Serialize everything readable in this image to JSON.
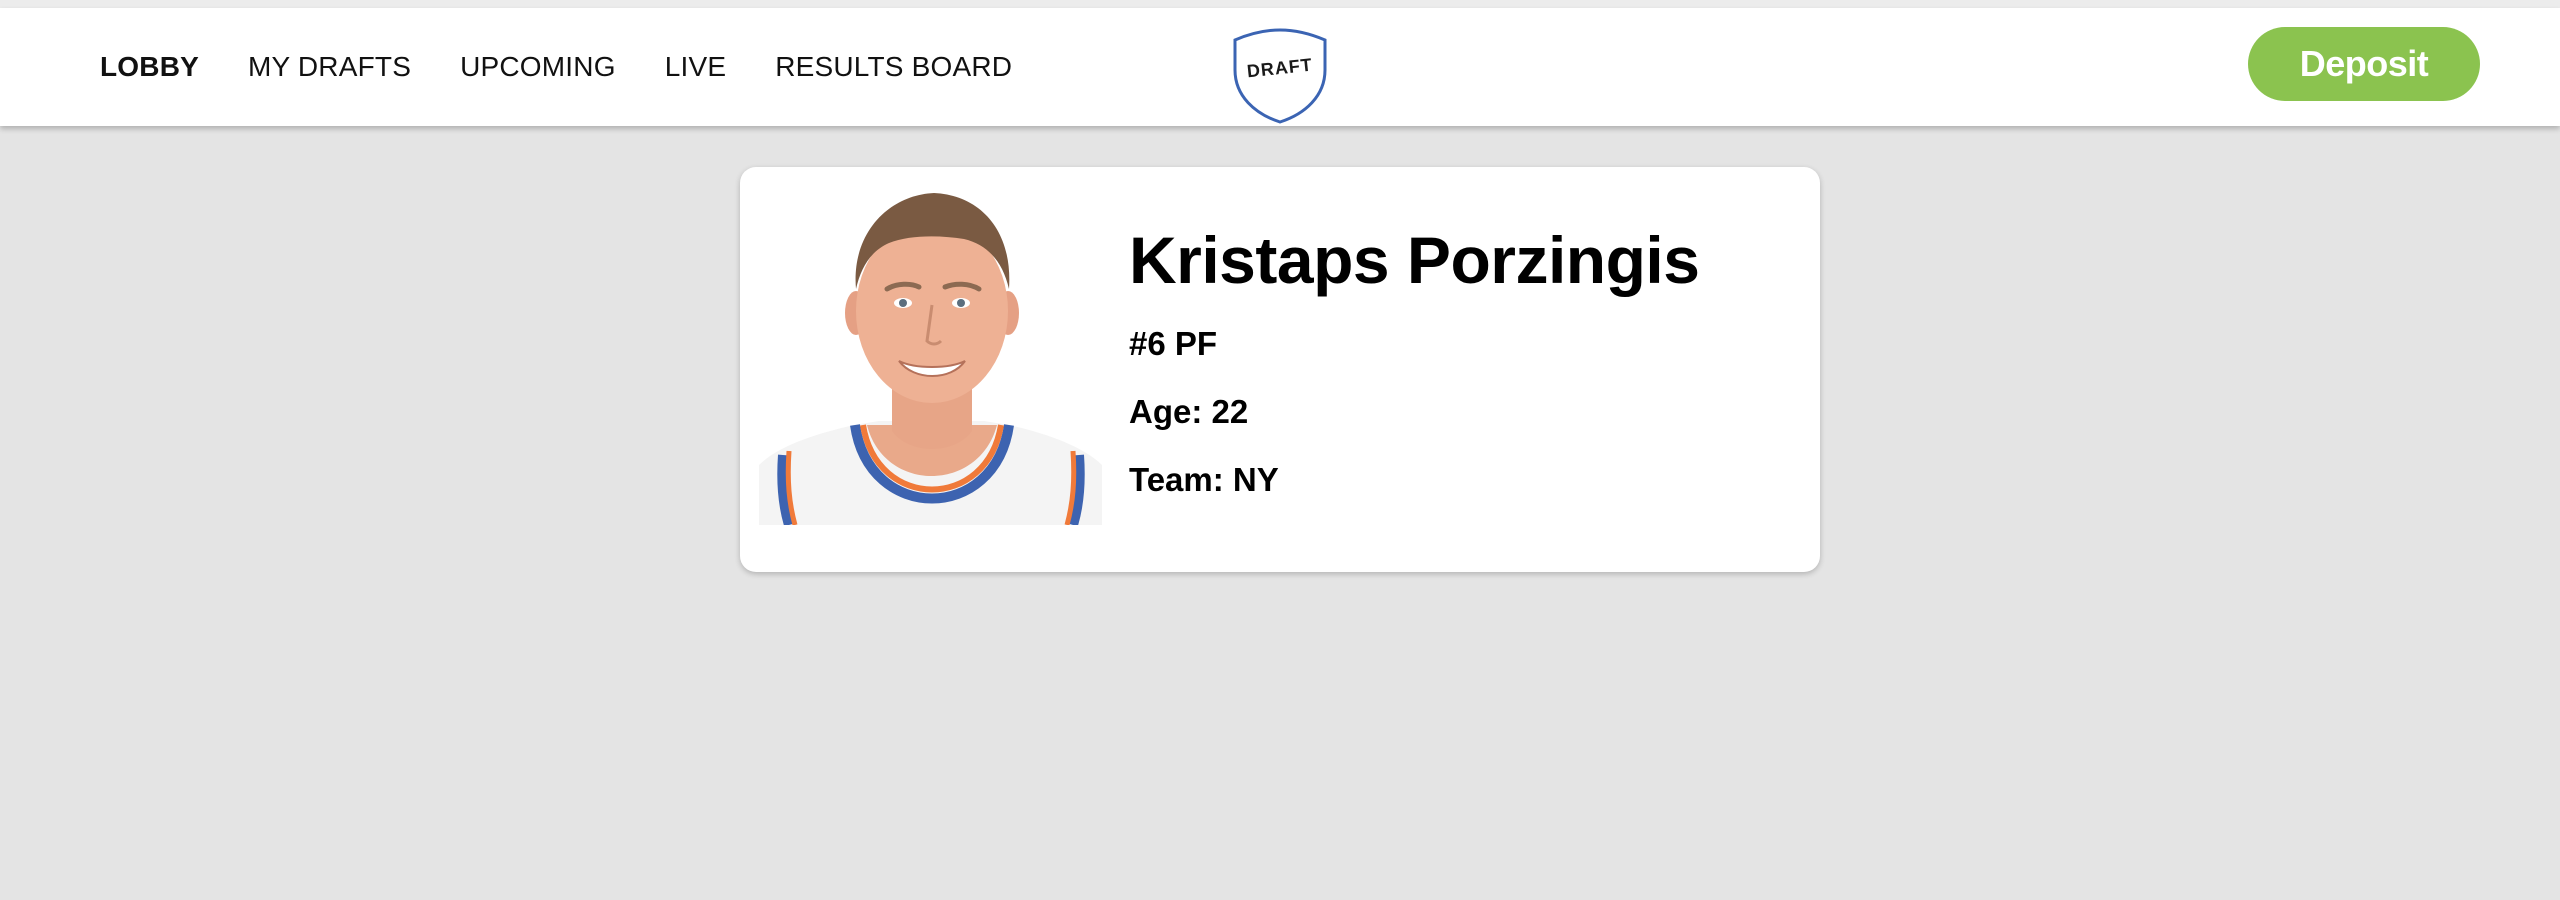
{
  "nav": {
    "links": [
      {
        "label": "LOBBY",
        "active": true
      },
      {
        "label": "MY DRAFTS",
        "active": false
      },
      {
        "label": "UPCOMING",
        "active": false
      },
      {
        "label": "LIVE",
        "active": false
      },
      {
        "label": "RESULTS BOARD",
        "active": false
      }
    ]
  },
  "logo": {
    "text": "DRAFT"
  },
  "deposit": {
    "label": "Deposit"
  },
  "player": {
    "name": "Kristaps Porzingis",
    "number_position": "#6 PF",
    "age": "Age: 22",
    "team": "Team: NY"
  },
  "colors": {
    "accent": "#8bc34f",
    "logo_blue": "#3b64b3",
    "background": "#e4e4e4",
    "jersey_orange": "#f07a3a",
    "jersey_blue": "#3d63b0"
  }
}
